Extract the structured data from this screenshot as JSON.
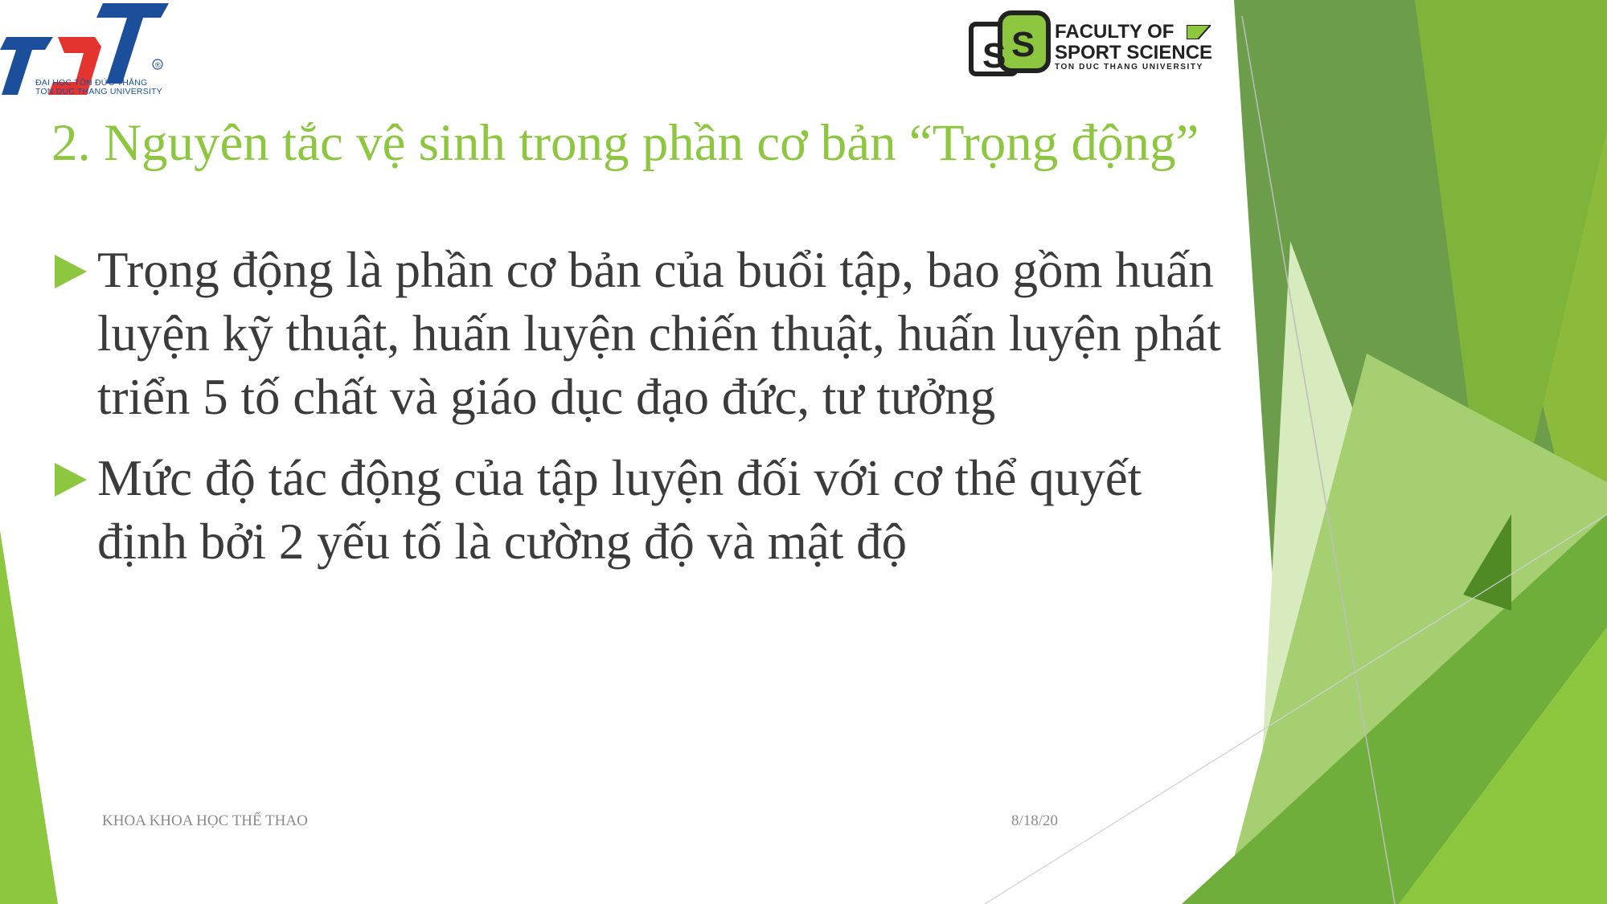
{
  "logos": {
    "tdt": {
      "mark": "TDT",
      "registered": "®",
      "line1": "ĐẠI HỌC TÔN ĐỨC THẮNG",
      "line2": "TON DUC THANG UNIVERSITY",
      "color": "#1b4f9c",
      "accent": "#e3342f"
    },
    "faculty": {
      "mark": "SS",
      "line1": "FACULTY OF",
      "line2": "SPORT SCIENCE",
      "line3": "TON DUC THANG UNIVERSITY",
      "color": "#8dc63f"
    }
  },
  "slide": {
    "title": "2. Nguyên tắc vệ sinh trong phần cơ bản “Trọng động”",
    "bullets": [
      "Trọng động là phần cơ bản của buổi tập, bao gồm huấn luyện kỹ thuật, huấn luyện chiến thuật, huấn luyện phát triển 5 tố chất và giáo dục đạo đức, tư tưởng",
      "Mức độ tác động của tập luyện đối với cơ thể quyết định bởi 2 yếu tố là cường độ và mật độ"
    ]
  },
  "footer": {
    "left": "KHOA KHOA HỌC THỂ THAO",
    "date": "8/18/20"
  },
  "theme": {
    "title_color": "#8dc63f",
    "text_color": "#3b3b3b",
    "green_dark": "#4e8a2a",
    "green_mid": "#6aa84f",
    "green_light": "#8dc63f",
    "green_pale": "#c9e3a4"
  }
}
